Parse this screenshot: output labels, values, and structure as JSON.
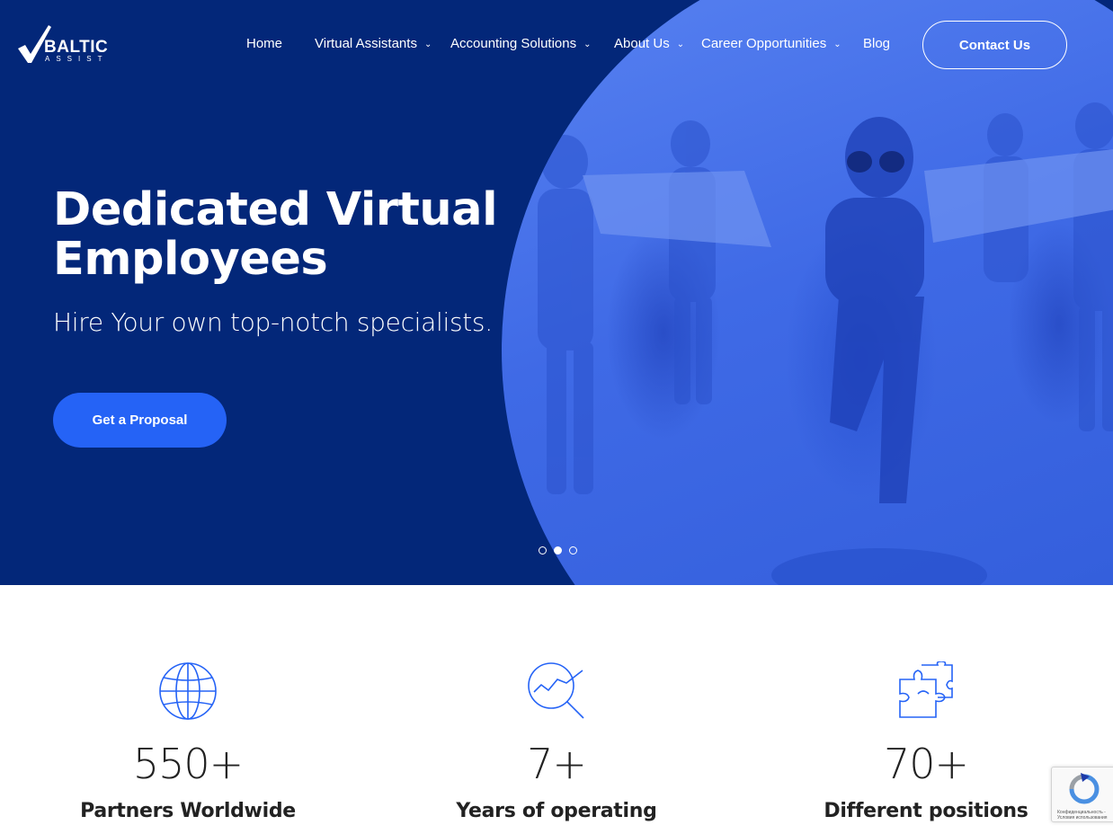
{
  "brand": {
    "name": "BALTIC",
    "tagline": "ASSIST"
  },
  "nav": {
    "items": [
      {
        "label": "Home",
        "has_dropdown": false
      },
      {
        "label": "Virtual Assistants",
        "has_dropdown": true
      },
      {
        "label": "Accounting Solutions",
        "has_dropdown": true
      },
      {
        "label": "About Us",
        "has_dropdown": true
      },
      {
        "label": "Career Opportunities",
        "has_dropdown": true
      },
      {
        "label": "Blog",
        "has_dropdown": false
      }
    ],
    "contact_label": "Contact Us"
  },
  "hero": {
    "title": "Dedicated Virtual Employees",
    "subtitle": "Hire Your own top-notch specialists.",
    "cta_label": "Get a Proposal",
    "slides": {
      "count": 3,
      "active": 2
    }
  },
  "stats": [
    {
      "icon": "globe-icon",
      "number": "550+",
      "label": "Partners Worldwide"
    },
    {
      "icon": "analytics-icon",
      "number": "7+",
      "label": "Years of operating"
    },
    {
      "icon": "puzzle-icon",
      "number": "70+",
      "label": "Different positions"
    }
  ],
  "recaptcha": {
    "text": "Конфиденциальность - Условия использования"
  },
  "colors": {
    "hero_bg": "#032779",
    "accent": "#2563f6",
    "icon_stroke": "#2563f6",
    "text_dark": "#222222"
  }
}
